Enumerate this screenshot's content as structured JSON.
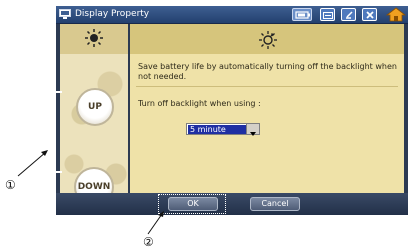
{
  "window": {
    "title": "Display Property",
    "titlebar_icons": [
      "monitor-icon",
      "battery-icon",
      "keyboard-icon",
      "minimize-icon",
      "close-icon",
      "home-icon"
    ]
  },
  "left_panel": {
    "header_icon": "sun-icon",
    "up_label": "UP",
    "down_label": "DOWN"
  },
  "right_panel": {
    "header_icon": "dim-sun-icon",
    "description": "Save battery life by automatically turning off the backlight when not needed.",
    "turnoff_label": "Turn off backlight when using :",
    "timeout_select": {
      "value": "5 minute"
    }
  },
  "buttons": {
    "ok_label": "OK",
    "cancel_label": "Cancel"
  },
  "callouts": {
    "one": "①",
    "two": "②"
  },
  "colors": {
    "titlebar": "#23406e",
    "panel_beige": "#efe2a8",
    "select_highlight": "#1f2fa3"
  }
}
